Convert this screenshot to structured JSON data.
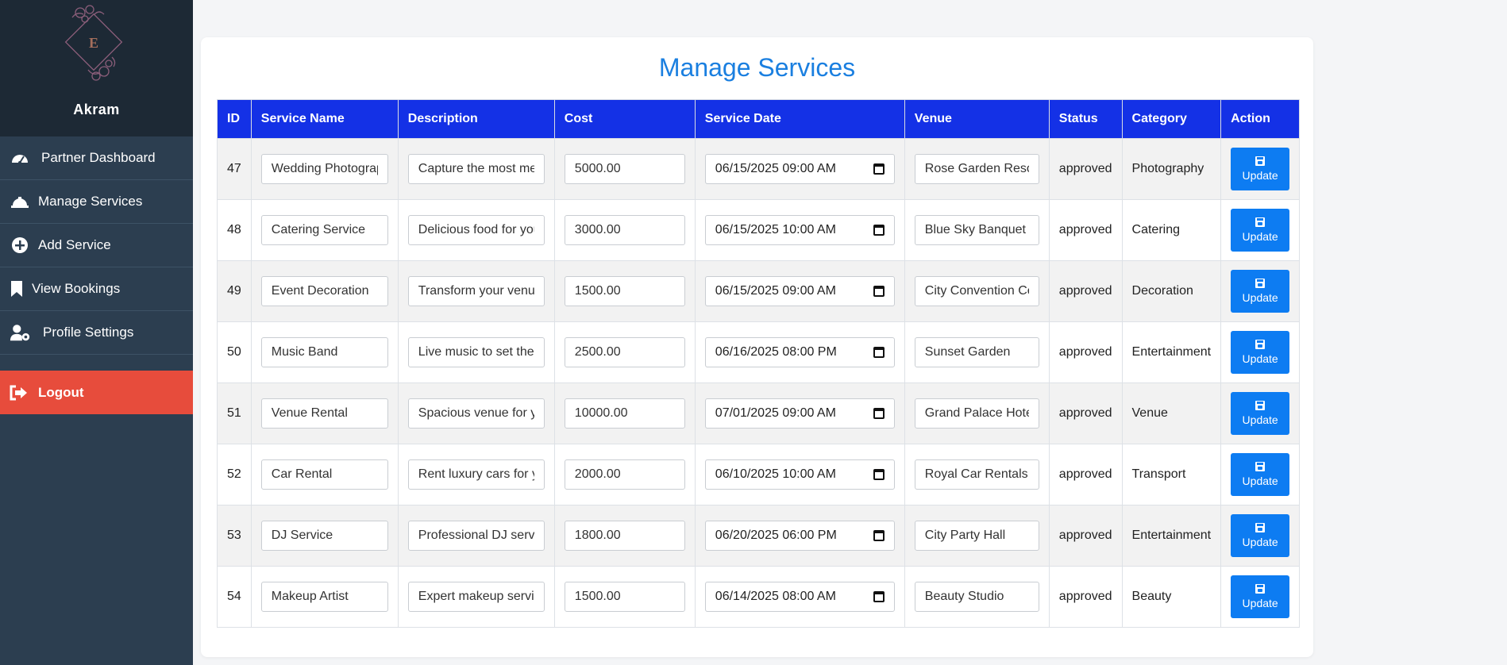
{
  "sidebar": {
    "logo_letter": "E",
    "partner_name": "Akram",
    "items": [
      {
        "label": "Partner Dashboard",
        "icon": "gauge-icon"
      },
      {
        "label": "Manage Services",
        "icon": "service-bell-icon"
      },
      {
        "label": "Add Service",
        "icon": "plus-circle-icon"
      },
      {
        "label": "View Bookings",
        "icon": "bookmark-icon"
      },
      {
        "label": "Profile Settings",
        "icon": "user-gear-icon"
      }
    ],
    "logout_label": "Logout",
    "logout_icon": "sign-out-icon"
  },
  "main": {
    "title": "Manage Services",
    "columns": [
      "ID",
      "Service Name",
      "Description",
      "Cost",
      "Service Date",
      "Venue",
      "Status",
      "Category",
      "Action"
    ],
    "update_label": "Update",
    "rows": [
      {
        "id": "47",
        "name": "Wedding Photography",
        "desc": "Capture the most memorable moments",
        "cost": "5000.00",
        "date": "06/15/2025 09:00 AM",
        "venue": "Rose Garden Resort",
        "status": "approved",
        "category": "Photography"
      },
      {
        "id": "48",
        "name": "Catering Service",
        "desc": "Delicious food for your guests",
        "cost": "3000.00",
        "date": "06/15/2025 10:00 AM",
        "venue": "Blue Sky Banquet",
        "status": "approved",
        "category": "Catering"
      },
      {
        "id": "49",
        "name": "Event Decoration",
        "desc": "Transform your venue",
        "cost": "1500.00",
        "date": "06/15/2025 09:00 AM",
        "venue": "City Convention Center",
        "status": "approved",
        "category": "Decoration"
      },
      {
        "id": "50",
        "name": "Music Band",
        "desc": "Live music to set the mood",
        "cost": "2500.00",
        "date": "06/16/2025 08:00 PM",
        "venue": "Sunset Garden",
        "status": "approved",
        "category": "Entertainment"
      },
      {
        "id": "51",
        "name": "Venue Rental",
        "desc": "Spacious venue for your event",
        "cost": "10000.00",
        "date": "07/01/2025 09:00 AM",
        "venue": "Grand Palace Hotel",
        "status": "approved",
        "category": "Venue"
      },
      {
        "id": "52",
        "name": "Car Rental",
        "desc": "Rent luxury cars for your event",
        "cost": "2000.00",
        "date": "06/10/2025 10:00 AM",
        "venue": "Royal Car Rentals",
        "status": "approved",
        "category": "Transport"
      },
      {
        "id": "53",
        "name": "DJ Service",
        "desc": "Professional DJ services",
        "cost": "1800.00",
        "date": "06/20/2025 06:00 PM",
        "venue": "City Party Hall",
        "status": "approved",
        "category": "Entertainment"
      },
      {
        "id": "54",
        "name": "Makeup Artist",
        "desc": "Expert makeup services",
        "cost": "1500.00",
        "date": "06/14/2025 08:00 AM",
        "venue": "Beauty Studio",
        "status": "approved",
        "category": "Beauty"
      }
    ]
  },
  "colors": {
    "sidebar_bg": "#2c3e50",
    "sidebar_header_bg": "#1d2935",
    "logout_bg": "#e74c3c",
    "table_header_bg": "#1431e6",
    "title_color": "#1a7fe0",
    "button_bg": "#0d7cf2"
  }
}
